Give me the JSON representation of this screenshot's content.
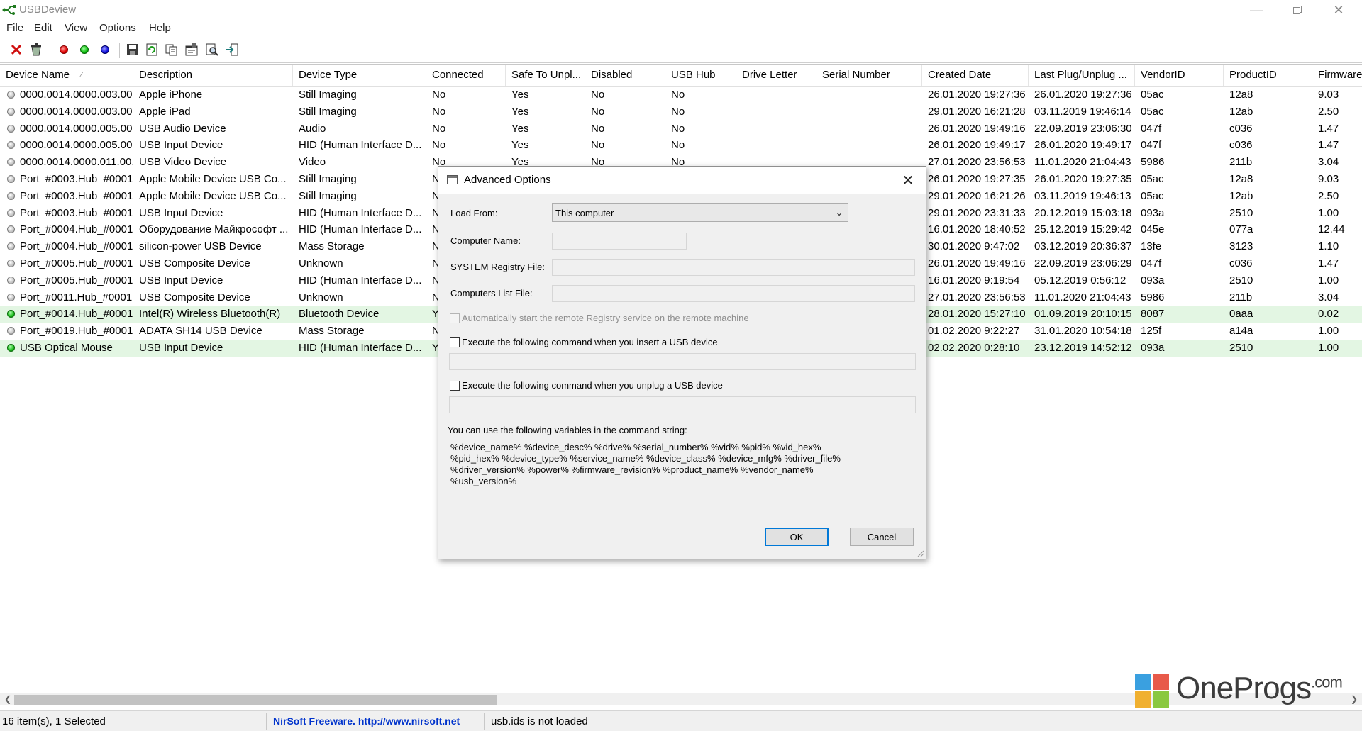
{
  "window": {
    "title": "USBDeview"
  },
  "menu": [
    "File",
    "Edit",
    "View",
    "Options",
    "Help"
  ],
  "toolbar_icons": [
    "delete-icon",
    "uninstall-icon",
    "disable-icon",
    "enable-icon",
    "enable-disable-icon",
    "save-icon",
    "refresh-icon",
    "copy-icon",
    "properties-icon",
    "find-icon",
    "exit-icon"
  ],
  "columns": [
    "Device Name",
    "Description",
    "Device Type",
    "Connected",
    "Safe To Unpl...",
    "Disabled",
    "USB Hub",
    "Drive Letter",
    "Serial Number",
    "Created Date",
    "Last Plug/Unplug ...",
    "VendorID",
    "ProductID",
    "Firmware"
  ],
  "rows": [
    {
      "status": "gray",
      "name": "0000.0014.0000.003.00...",
      "desc": "Apple iPhone",
      "type": "Still Imaging",
      "connected": "No",
      "safe": "Yes",
      "disabled": "No",
      "hub": "No",
      "drive": "",
      "serial": "",
      "created": "26.01.2020 19:27:36",
      "last": "26.01.2020 19:27:36",
      "vid": "05ac",
      "pid": "12a8",
      "fw": "9.03",
      "selected": false
    },
    {
      "status": "gray",
      "name": "0000.0014.0000.003.00...",
      "desc": "Apple iPad",
      "type": "Still Imaging",
      "connected": "No",
      "safe": "Yes",
      "disabled": "No",
      "hub": "No",
      "drive": "",
      "serial": "",
      "created": "29.01.2020 16:21:28",
      "last": "03.11.2019 19:46:14",
      "vid": "05ac",
      "pid": "12ab",
      "fw": "2.50",
      "selected": false
    },
    {
      "status": "gray",
      "name": "0000.0014.0000.005.00...",
      "desc": "USB Audio Device",
      "type": "Audio",
      "connected": "No",
      "safe": "Yes",
      "disabled": "No",
      "hub": "No",
      "drive": "",
      "serial": "",
      "created": "26.01.2020 19:49:16",
      "last": "22.09.2019 23:06:30",
      "vid": "047f",
      "pid": "c036",
      "fw": "1.47",
      "selected": false
    },
    {
      "status": "gray",
      "name": "0000.0014.0000.005.00...",
      "desc": "USB Input Device",
      "type": "HID (Human Interface D...",
      "connected": "No",
      "safe": "Yes",
      "disabled": "No",
      "hub": "No",
      "drive": "",
      "serial": "",
      "created": "26.01.2020 19:49:17",
      "last": "26.01.2020 19:49:17",
      "vid": "047f",
      "pid": "c036",
      "fw": "1.47",
      "selected": false
    },
    {
      "status": "gray",
      "name": "0000.0014.0000.011.00...",
      "desc": "USB Video Device",
      "type": "Video",
      "connected": "No",
      "safe": "Yes",
      "disabled": "No",
      "hub": "No",
      "drive": "",
      "serial": "",
      "created": "27.01.2020 23:56:53",
      "last": "11.01.2020 21:04:43",
      "vid": "5986",
      "pid": "211b",
      "fw": "3.04",
      "selected": false
    },
    {
      "status": "gray",
      "name": "Port_#0003.Hub_#0001",
      "desc": "Apple Mobile Device USB Co...",
      "type": "Still Imaging",
      "connected": "N",
      "safe": "",
      "disabled": "",
      "hub": "",
      "drive": "",
      "serial": "",
      "created": "26.01.2020 19:27:35",
      "last": "26.01.2020 19:27:35",
      "vid": "05ac",
      "pid": "12a8",
      "fw": "9.03",
      "selected": false
    },
    {
      "status": "gray",
      "name": "Port_#0003.Hub_#0001",
      "desc": "Apple Mobile Device USB Co...",
      "type": "Still Imaging",
      "connected": "N",
      "safe": "",
      "disabled": "",
      "hub": "",
      "drive": "",
      "serial": "",
      "created": "29.01.2020 16:21:26",
      "last": "03.11.2019 19:46:13",
      "vid": "05ac",
      "pid": "12ab",
      "fw": "2.50",
      "selected": false
    },
    {
      "status": "gray",
      "name": "Port_#0003.Hub_#0001",
      "desc": "USB Input Device",
      "type": "HID (Human Interface D...",
      "connected": "N",
      "safe": "",
      "disabled": "",
      "hub": "",
      "drive": "",
      "serial": "",
      "created": "29.01.2020 23:31:33",
      "last": "20.12.2019 15:03:18",
      "vid": "093a",
      "pid": "2510",
      "fw": "1.00",
      "selected": false
    },
    {
      "status": "gray",
      "name": "Port_#0004.Hub_#0001",
      "desc": "Оборудование Майкрософт ...",
      "type": "HID (Human Interface D...",
      "connected": "N",
      "safe": "",
      "disabled": "",
      "hub": "",
      "drive": "",
      "serial": "",
      "created": "16.01.2020 18:40:52",
      "last": "25.12.2019 15:29:42",
      "vid": "045e",
      "pid": "077a",
      "fw": "12.44",
      "selected": false
    },
    {
      "status": "gray",
      "name": "Port_#0004.Hub_#0001",
      "desc": "silicon-power USB Device",
      "type": "Mass Storage",
      "connected": "N",
      "safe": "",
      "disabled": "",
      "hub": "",
      "drive": "",
      "serial": "",
      "created": "30.01.2020 9:47:02",
      "last": "03.12.2019 20:36:37",
      "vid": "13fe",
      "pid": "3123",
      "fw": "1.10",
      "selected": false
    },
    {
      "status": "gray",
      "name": "Port_#0005.Hub_#0001",
      "desc": "USB Composite Device",
      "type": "Unknown",
      "connected": "N",
      "safe": "",
      "disabled": "",
      "hub": "",
      "drive": "",
      "serial": "",
      "created": "26.01.2020 19:49:16",
      "last": "22.09.2019 23:06:29",
      "vid": "047f",
      "pid": "c036",
      "fw": "1.47",
      "selected": false
    },
    {
      "status": "gray",
      "name": "Port_#0005.Hub_#0001",
      "desc": "USB Input Device",
      "type": "HID (Human Interface D...",
      "connected": "N",
      "safe": "",
      "disabled": "",
      "hub": "",
      "drive": "",
      "serial": "",
      "created": "16.01.2020 9:19:54",
      "last": "05.12.2019 0:56:12",
      "vid": "093a",
      "pid": "2510",
      "fw": "1.00",
      "selected": false
    },
    {
      "status": "gray",
      "name": "Port_#0011.Hub_#0001",
      "desc": "USB Composite Device",
      "type": "Unknown",
      "connected": "N",
      "safe": "",
      "disabled": "",
      "hub": "",
      "drive": "",
      "serial": "",
      "created": "27.01.2020 23:56:53",
      "last": "11.01.2020 21:04:43",
      "vid": "5986",
      "pid": "211b",
      "fw": "3.04",
      "selected": false
    },
    {
      "status": "green",
      "name": "Port_#0014.Hub_#0001",
      "desc": "Intel(R) Wireless Bluetooth(R)",
      "type": "Bluetooth Device",
      "connected": "Y",
      "safe": "",
      "disabled": "",
      "hub": "",
      "drive": "",
      "serial": "",
      "created": "28.01.2020 15:27:10",
      "last": "01.09.2019 20:10:15",
      "vid": "8087",
      "pid": "0aaa",
      "fw": "0.02",
      "selected": true
    },
    {
      "status": "gray",
      "name": "Port_#0019.Hub_#0001",
      "desc": "ADATA SH14 USB Device",
      "type": "Mass Storage",
      "connected": "N",
      "safe": "",
      "disabled": "",
      "hub": "",
      "drive": "",
      "serial": "",
      "created": "01.02.2020 9:22:27",
      "last": "31.01.2020 10:54:18",
      "vid": "125f",
      "pid": "a14a",
      "fw": "1.00",
      "selected": false
    },
    {
      "status": "green",
      "name": "USB Optical Mouse",
      "desc": "USB Input Device",
      "type": "HID (Human Interface D...",
      "connected": "Y",
      "safe": "",
      "disabled": "",
      "hub": "",
      "drive": "",
      "serial": "",
      "created": "02.02.2020 0:28:10",
      "last": "23.12.2019 14:52:12",
      "vid": "093a",
      "pid": "2510",
      "fw": "1.00",
      "selected": true
    }
  ],
  "status_bar": {
    "count": "16 item(s), 1 Selected",
    "nirsoft_label": "NirSoft Freeware.  http://www.nirsoft.net",
    "usbids": "usb.ids is not loaded"
  },
  "watermark": {
    "name": "OneProgs",
    "suffix": ".com"
  },
  "dialog": {
    "title": "Advanced Options",
    "load_from_label": "Load From:",
    "load_from_value": "This computer",
    "computer_name_label": "Computer Name:",
    "system_registry_label": "SYSTEM Registry File:",
    "computers_list_label": "Computers List File:",
    "auto_start_label": "Automatically start the remote Registry service on the remote machine",
    "insert_cmd_label": "Execute the following command when you insert a USB device",
    "unplug_cmd_label": "Execute the following command when you unplug a USB device",
    "variables_intro": "You can use the following variables in the command string:",
    "variables_lines": [
      "%device_name%  %device_desc%  %drive%  %serial_number%  %vid%  %pid%  %vid_hex%",
      "%pid_hex% %device_type% %service_name% %device_class% %device_mfg% %driver_file%",
      "%driver_version% %power% %firmware_revision% %product_name% %vendor_name%",
      "%usb_version%"
    ],
    "ok_label": "OK",
    "cancel_label": "Cancel"
  },
  "colors": {
    "selected_row": "#e3f6e3",
    "link_blue": "#0033cc",
    "accent": "#0078d7"
  }
}
